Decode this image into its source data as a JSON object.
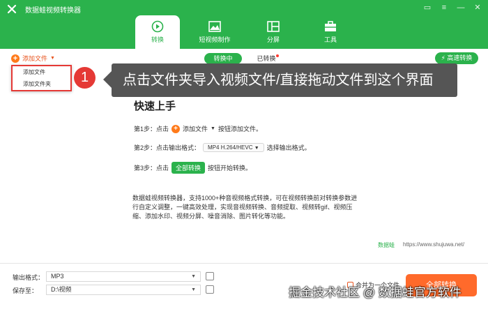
{
  "app": {
    "title": "数据蛙视频转换器"
  },
  "nav": {
    "tabs": [
      {
        "label": "转换",
        "icon": "convert-icon",
        "active": true
      },
      {
        "label": "短视频制作",
        "icon": "image-icon",
        "active": false
      },
      {
        "label": "分屏",
        "icon": "split-screen-icon",
        "active": false
      },
      {
        "label": "工具",
        "icon": "toolbox-icon",
        "active": false
      }
    ]
  },
  "toolbar": {
    "add_file_label": "添加文件",
    "converting_label": "转换中",
    "converted_label": "已转换",
    "fast_convert_label": "高速转换"
  },
  "dropdown": {
    "items": [
      "添加文件",
      "添加文件夹"
    ]
  },
  "callout": {
    "number": "1",
    "text": "点击文件夹导入视频文件/直接拖动文件到这个界面"
  },
  "quick_start": {
    "title": "快速上手",
    "step1": {
      "prefix": "第1步：点击",
      "button": "添加文件",
      "suffix": "按钮添加文件。"
    },
    "step2": {
      "prefix": "第2步：点击输出格式：",
      "format": "MP4 H.264/HEVC",
      "suffix": "选择输出格式。"
    },
    "step3": {
      "prefix": "第3步：点击",
      "button": "全部转换",
      "suffix": "按钮开始转换。"
    },
    "description": "数据蛙视频转换器，支持1000+种音视频格式转换，可在视频转换前对转换参数进行自定义调整，一键高效处理，实现音视频转换、音频提取、视频转gif、视频压缩、添加水印、视频分屏、噪音消除、图片转化等功能。"
  },
  "footer_brand": {
    "name": "数据蛙",
    "url": "https://www.shujuwa.net/"
  },
  "bottom": {
    "output_format_label": "输出格式：",
    "output_format_value": "MP3",
    "save_to_label": "保存至：",
    "save_to_value": "D:\\视频",
    "merge_label": "合并为一个文件",
    "convert_all_label": "全部转换"
  },
  "watermark": "掘金技术社区 @ 数据蛙官方软件",
  "colors": {
    "brand_green": "#2bb24c",
    "accent_orange": "#ff6a2b",
    "highlight_red": "#e53935"
  }
}
